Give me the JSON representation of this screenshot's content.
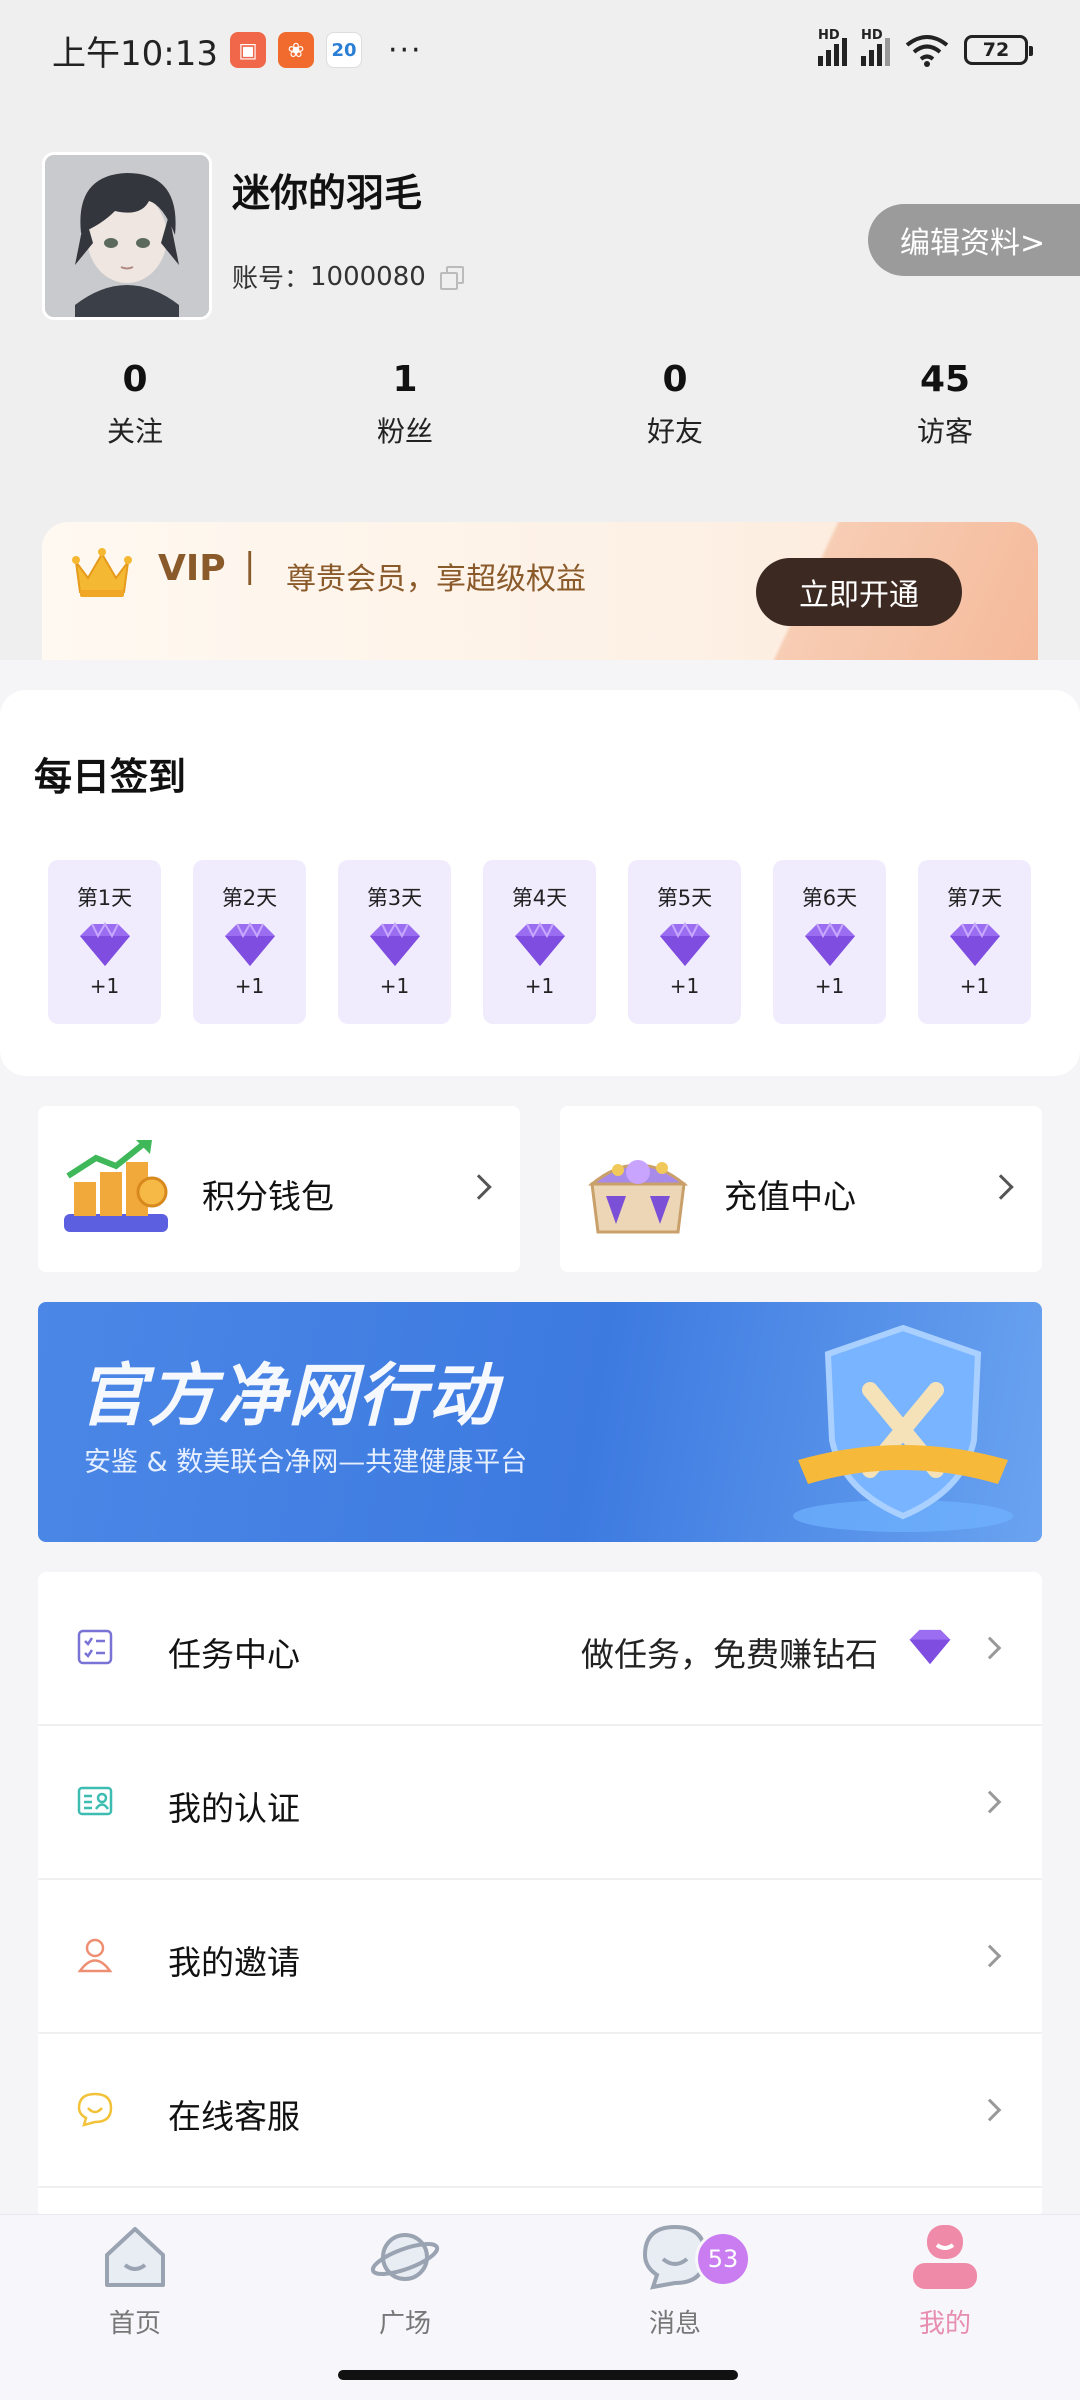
{
  "status_bar": {
    "time": "上午10:13",
    "app_icon_3": "20",
    "more": "···",
    "battery": "72",
    "hd_label": "HD"
  },
  "profile": {
    "username": "迷你的羽毛",
    "account_label": "账号：",
    "account_id": "1000080",
    "edit_button": "编辑资料>"
  },
  "stats": [
    {
      "value": "0",
      "label": "关注"
    },
    {
      "value": "1",
      "label": "粉丝"
    },
    {
      "value": "0",
      "label": "好友"
    },
    {
      "value": "45",
      "label": "访客"
    }
  ],
  "vip": {
    "title": "VIP",
    "separator": "|",
    "description": "尊贵会员，享超级权益",
    "button": "立即开通"
  },
  "signin": {
    "title": "每日签到",
    "days": [
      {
        "label": "第1天",
        "reward": "+1"
      },
      {
        "label": "第2天",
        "reward": "+1"
      },
      {
        "label": "第3天",
        "reward": "+1"
      },
      {
        "label": "第4天",
        "reward": "+1"
      },
      {
        "label": "第5天",
        "reward": "+1"
      },
      {
        "label": "第6天",
        "reward": "+1"
      },
      {
        "label": "第7天",
        "reward": "+1"
      }
    ]
  },
  "shortcuts": {
    "wallet": "积分钱包",
    "recharge": "充值中心"
  },
  "banner": {
    "title": "官方净网行动",
    "subtitle": "安鉴 & 数美联合净网—共建健康平台"
  },
  "menu": {
    "items": [
      {
        "label": "任务中心",
        "hint": "做任务，免费赚钻石",
        "icon": "task-list-icon"
      },
      {
        "label": "我的认证",
        "hint": "",
        "icon": "id-card-icon"
      },
      {
        "label": "我的邀请",
        "hint": "",
        "icon": "user-icon"
      },
      {
        "label": "在线客服",
        "hint": "",
        "icon": "chat-bubble-icon"
      }
    ]
  },
  "bottom_nav": {
    "items": [
      {
        "label": "首页",
        "icon": "home-icon"
      },
      {
        "label": "广场",
        "icon": "planet-icon"
      },
      {
        "label": "消息",
        "icon": "message-icon"
      },
      {
        "label": "我的",
        "icon": "profile-icon"
      }
    ],
    "message_badge": "53",
    "active": "我的"
  },
  "colors": {
    "accent_pink": "#e78dae",
    "badge_purple": "#c97df0",
    "vip_brown": "#8a5a2b",
    "banner_blue": "#4b87e6"
  }
}
